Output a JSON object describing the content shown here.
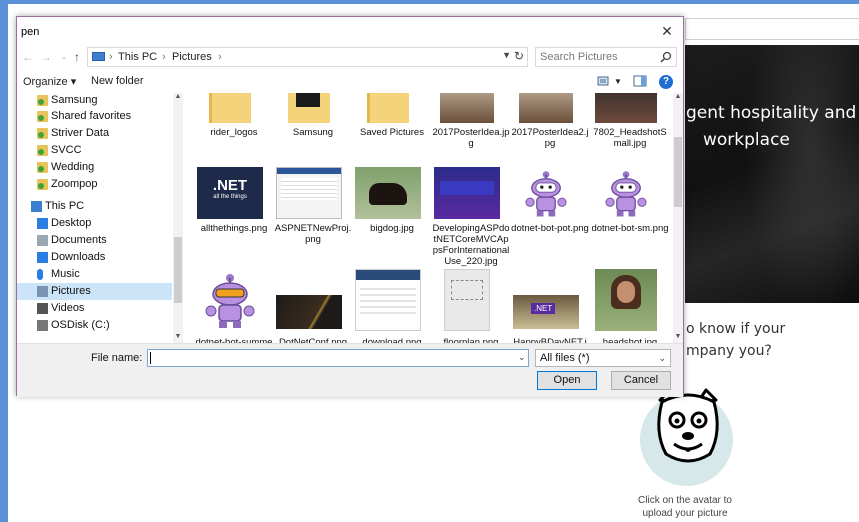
{
  "background_page": {
    "hero_line1": "gent hospitality and",
    "hero_line2": "workplace",
    "question_line1": "o know if your",
    "question_line2": "mpany you?",
    "avatar_caption_line1": "Click on the avatar to",
    "avatar_caption_line2": "upload your picture"
  },
  "dialog": {
    "title": "pen",
    "close_glyph": "✕",
    "address": {
      "crumb_pc": "This PC",
      "crumb_pictures": "Pictures",
      "separator": "›"
    },
    "search_placeholder": "Search Pictures",
    "toolbar": {
      "organize": "Organize ▾",
      "new_folder": "New folder",
      "help": "?"
    },
    "nav_items": [
      {
        "label": "Samsung",
        "icon": "folder-icon"
      },
      {
        "label": "Shared favorites",
        "icon": "folder-icon"
      },
      {
        "label": "Striver Data",
        "icon": "folder-icon"
      },
      {
        "label": "SVCC",
        "icon": "folder-icon"
      },
      {
        "label": "Wedding",
        "icon": "folder-icon"
      },
      {
        "label": "Zoompop",
        "icon": "folder-icon"
      },
      {
        "label": "This PC",
        "icon": "pc-icon"
      },
      {
        "label": "Desktop",
        "icon": "desktop-icon"
      },
      {
        "label": "Documents",
        "icon": "documents-icon"
      },
      {
        "label": "Downloads",
        "icon": "downloads-icon"
      },
      {
        "label": "Music",
        "icon": "music-icon"
      },
      {
        "label": "Pictures",
        "icon": "pictures-icon",
        "selected": true
      },
      {
        "label": "Videos",
        "icon": "videos-icon"
      },
      {
        "label": "OSDisk (C:)",
        "icon": "disk-icon"
      }
    ],
    "files": [
      {
        "name": "rider_logos",
        "kind": "folder"
      },
      {
        "name": "Samsung",
        "kind": "folder-dark"
      },
      {
        "name": "Saved Pictures",
        "kind": "folder"
      },
      {
        "name": "2017PosterIdea.jpg",
        "kind": "photo-brown"
      },
      {
        "name": "2017PosterIdea2.jpg",
        "kind": "photo-brown"
      },
      {
        "name": "7802_HeadshotSmall.jpg",
        "kind": "photo-person"
      },
      {
        "name": "allthethings.png",
        "kind": "net-logo",
        "thumb_text": ".NET",
        "thumb_sub": "all the things"
      },
      {
        "name": "ASPNETNewProj.png",
        "kind": "screenshot"
      },
      {
        "name": "bigdog.jpg",
        "kind": "dog"
      },
      {
        "name": "DevelopingASPdotNETCoreMVCAppsForInternationalUse_220.jpg",
        "kind": "video"
      },
      {
        "name": "dotnet-bot-pot.png",
        "kind": "bot"
      },
      {
        "name": "dotnet-bot-sm.png",
        "kind": "bot"
      },
      {
        "name": "dotnet-bot-summer.png",
        "kind": "bot-summer"
      },
      {
        "name": "DotNetConf.png",
        "kind": "dark"
      },
      {
        "name": "download.png",
        "kind": "webpage"
      },
      {
        "name": "floorplan.png",
        "kind": "floorplan"
      },
      {
        "name": "HappyBDayNET.jpg",
        "kind": "cake",
        "thumb_text": ".NET"
      },
      {
        "name": "headshot.jpg",
        "kind": "headshot"
      }
    ],
    "filename_label": "File name:",
    "filename_value": "",
    "filetype_value": "All files (*)",
    "open_label": "Open",
    "cancel_label": "Cancel"
  }
}
